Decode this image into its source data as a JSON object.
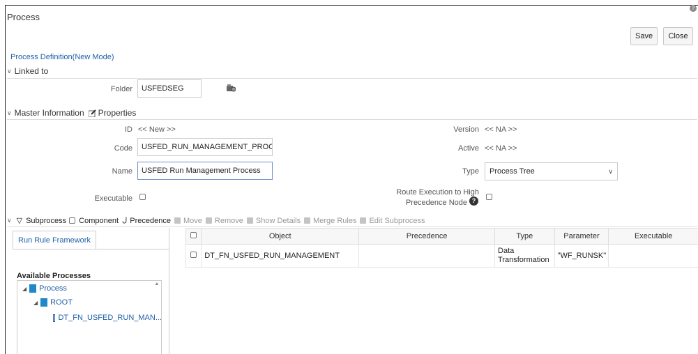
{
  "header": {
    "title": "Process",
    "help_glyph": "?",
    "save_label": "Save",
    "close_label": "Close"
  },
  "breadcrumb": "Process Definition(New Mode)",
  "linked_to": {
    "header": "Linked to",
    "folder_label": "Folder",
    "folder_value": "USFEDSEG"
  },
  "master": {
    "header": "Master Information",
    "properties_label": "Properties",
    "id_label": "ID",
    "id_value": "<< New >>",
    "version_label": "Version",
    "version_value": "<< NA >>",
    "code_label": "Code",
    "code_value": "USFED_RUN_MANAGEMENT_PROCESS",
    "active_label": "Active",
    "active_value": "<< NA >>",
    "name_label": "Name",
    "name_value": "USFED Run Management Process",
    "type_label": "Type",
    "type_value": "Process Tree",
    "executable_label": "Executable",
    "route_label_1": "Route Execution to High",
    "route_label_2": "Precedence Node",
    "route_help_glyph": "?"
  },
  "toolbar": {
    "subprocess": "Subprocess",
    "component": "Component",
    "precedence": "Precedence",
    "move": "Move",
    "remove": "Remove",
    "show_details": "Show Details",
    "merge_rules": "Merge Rules",
    "edit_subprocess": "Edit Subprocess"
  },
  "left_panel": {
    "tab": "Run Rule Framework",
    "available_title": "Available Processes",
    "tree": [
      "Process",
      "ROOT",
      "DT_FN_USFED_RUN_MAN..."
    ]
  },
  "grid": {
    "columns": [
      "Object",
      "Precedence",
      "Type",
      "Parameter",
      "Executable"
    ],
    "rows": [
      {
        "object": "DT_FN_USFED_RUN_MANAGEMENT",
        "precedence": "",
        "type_1": "Data",
        "type_2": "Transformation",
        "parameter": "\"WF_RUNSK\"",
        "executable": ""
      }
    ]
  },
  "icons": {
    "accent": "#1f5fa8",
    "folder": "#1e88c9"
  }
}
